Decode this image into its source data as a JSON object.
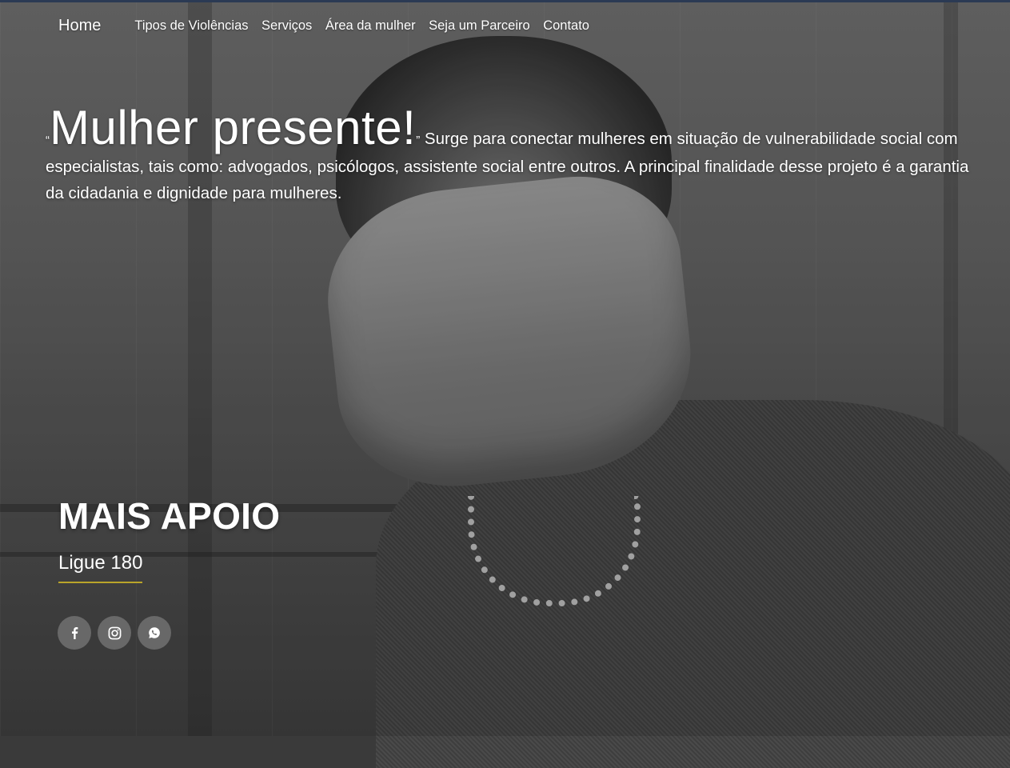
{
  "nav": {
    "home": "Home",
    "items": [
      "Tipos de Violências",
      "Serviços",
      "Área da mulher",
      "Seja um Parceiro",
      "Contato"
    ]
  },
  "intro": {
    "quote_open": "“",
    "headline": "Mulher presente!",
    "quote_close": "”",
    "text": " Surge para conectar mulheres em situação de vulnerabilidade social com especialistas, tais como: advogados, psicólogos, assistente social entre outros. A principal finalidade desse projeto é a garantia da cidadania e dignidade para mulheres."
  },
  "support": {
    "title": "MAIS APOIO",
    "phone": "Ligue 180"
  },
  "social": [
    "facebook-icon",
    "instagram-icon",
    "whatsapp-icon"
  ],
  "colors": {
    "accent_underline": "#b9a42a",
    "topline": "#2b3a54"
  }
}
